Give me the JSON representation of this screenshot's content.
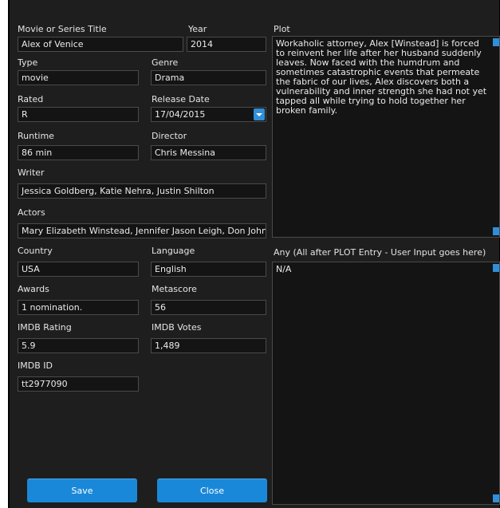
{
  "fields": {
    "title": {
      "label": "Movie or Series Title",
      "value": "Alex of Venice"
    },
    "year": {
      "label": "Year",
      "value": "2014"
    },
    "type": {
      "label": "Type",
      "value": "movie"
    },
    "genre": {
      "label": "Genre",
      "value": "Drama"
    },
    "rated": {
      "label": "Rated",
      "value": "R"
    },
    "release_date": {
      "label": "Release Date",
      "value": "17/04/2015"
    },
    "runtime": {
      "label": "Runtime",
      "value": "86 min"
    },
    "director": {
      "label": "Director",
      "value": "Chris Messina"
    },
    "writer": {
      "label": "Writer",
      "value": "Jessica Goldberg, Katie Nehra, Justin Shilton"
    },
    "actors": {
      "label": "Actors",
      "value": "Mary Elizabeth Winstead, Jennifer Jason Leigh, Don Johnson"
    },
    "country": {
      "label": "Country",
      "value": "USA"
    },
    "language": {
      "label": "Language",
      "value": "English"
    },
    "awards": {
      "label": "Awards",
      "value": "1 nomination."
    },
    "metascore": {
      "label": "Metascore",
      "value": "56"
    },
    "imdb_rating": {
      "label": "IMDB Rating",
      "value": "5.9"
    },
    "imdb_votes": {
      "label": "IMDB Votes",
      "value": "1,489"
    },
    "imdb_id": {
      "label": "IMDB ID",
      "value": "tt2977090"
    }
  },
  "plot": {
    "label": "Plot",
    "value": "Workaholic attorney, Alex [Winstead] is forced to reinvent her life after her husband suddenly leaves. Now faced with the humdrum and sometimes catastrophic events that permeate the fabric of our lives, Alex discovers both a vulnerability and inner strength she had not yet tapped all while trying to hold together her broken family."
  },
  "any": {
    "label": "Any (All after PLOT Entry - User Input goes here)",
    "value": "N/A"
  },
  "buttons": {
    "save": "Save",
    "close": "Close"
  },
  "colors": {
    "background": "#1e1e1e",
    "field_bg": "#141414",
    "accent": "#1a88d8"
  }
}
